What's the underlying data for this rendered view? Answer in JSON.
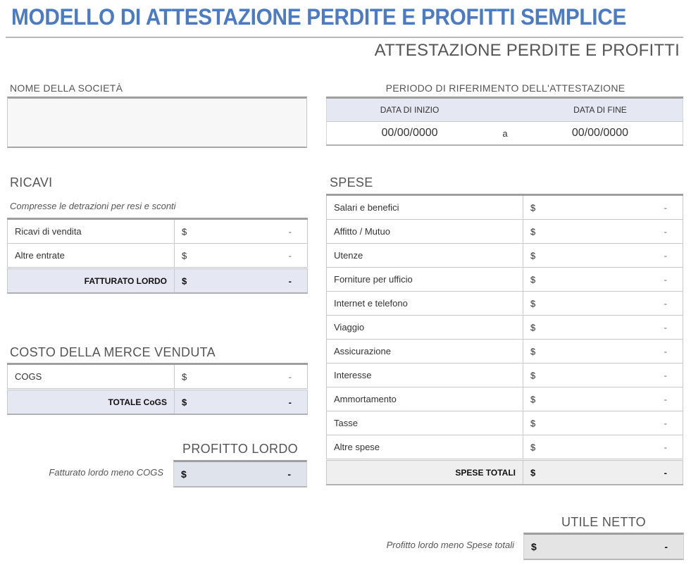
{
  "header": {
    "title": "MODELLO DI ATTESTAZIONE PERDITE E PROFITTI SEMPLICE",
    "subtitle": "ATTESTAZIONE PERDITE E PROFITTI",
    "title_color": "#4a7bc4"
  },
  "company": {
    "label": "NOME DELLA SOCIETÀ",
    "value": ""
  },
  "period": {
    "label": "PERIODO DI RIFERIMENTO DELL'ATTESTAZIONE",
    "start_label": "DATA DI INIZIO",
    "end_label": "DATA DI FINE",
    "start_value": "00/00/0000",
    "separator": "a",
    "end_value": "00/00/0000"
  },
  "revenue": {
    "heading": "RICAVI",
    "note": "Compresse le detrazioni per resi e sconti",
    "rows": [
      {
        "label": "Ricavi di vendita",
        "currency": "$",
        "value": "-"
      },
      {
        "label": "Altre entrate",
        "currency": "$",
        "value": "-"
      }
    ],
    "total": {
      "label": "FATTURATO LORDO",
      "currency": "$",
      "value": "-"
    }
  },
  "cogs": {
    "heading": "COSTO DELLA MERCE VENDUTA",
    "rows": [
      {
        "label": "COGS",
        "currency": "$",
        "value": "-"
      }
    ],
    "total": {
      "label": "TOTALE CoGS",
      "currency": "$",
      "value": "-"
    }
  },
  "gross_profit": {
    "heading": "PROFITTO LORDO",
    "note": "Fatturato lordo meno COGS",
    "currency": "$",
    "value": "-",
    "bg_color": "#dfe3ec"
  },
  "expenses": {
    "heading": "SPESE",
    "rows": [
      {
        "label": "Salari e benefici",
        "currency": "$",
        "value": "-"
      },
      {
        "label": "Affitto / Mutuo",
        "currency": "$",
        "value": "-"
      },
      {
        "label": "Utenze",
        "currency": "$",
        "value": "-"
      },
      {
        "label": "Forniture per ufficio",
        "currency": "$",
        "value": "-"
      },
      {
        "label": "Internet e telefono",
        "currency": "$",
        "value": "-"
      },
      {
        "label": "Viaggio",
        "currency": "$",
        "value": "-"
      },
      {
        "label": "Assicurazione",
        "currency": "$",
        "value": "-"
      },
      {
        "label": "Interesse",
        "currency": "$",
        "value": "-"
      },
      {
        "label": "Ammortamento",
        "currency": "$",
        "value": "-"
      },
      {
        "label": "Tasse",
        "currency": "$",
        "value": "-"
      },
      {
        "label": "Altre spese",
        "currency": "$",
        "value": "-"
      }
    ],
    "total": {
      "label": "SPESE TOTALI",
      "currency": "$",
      "value": "-"
    }
  },
  "net_income": {
    "heading": "UTILE NETTO",
    "note": "Profitto lordo meno Spese totali",
    "currency": "$",
    "value": "-",
    "bg_color": "#e4e4e4"
  }
}
